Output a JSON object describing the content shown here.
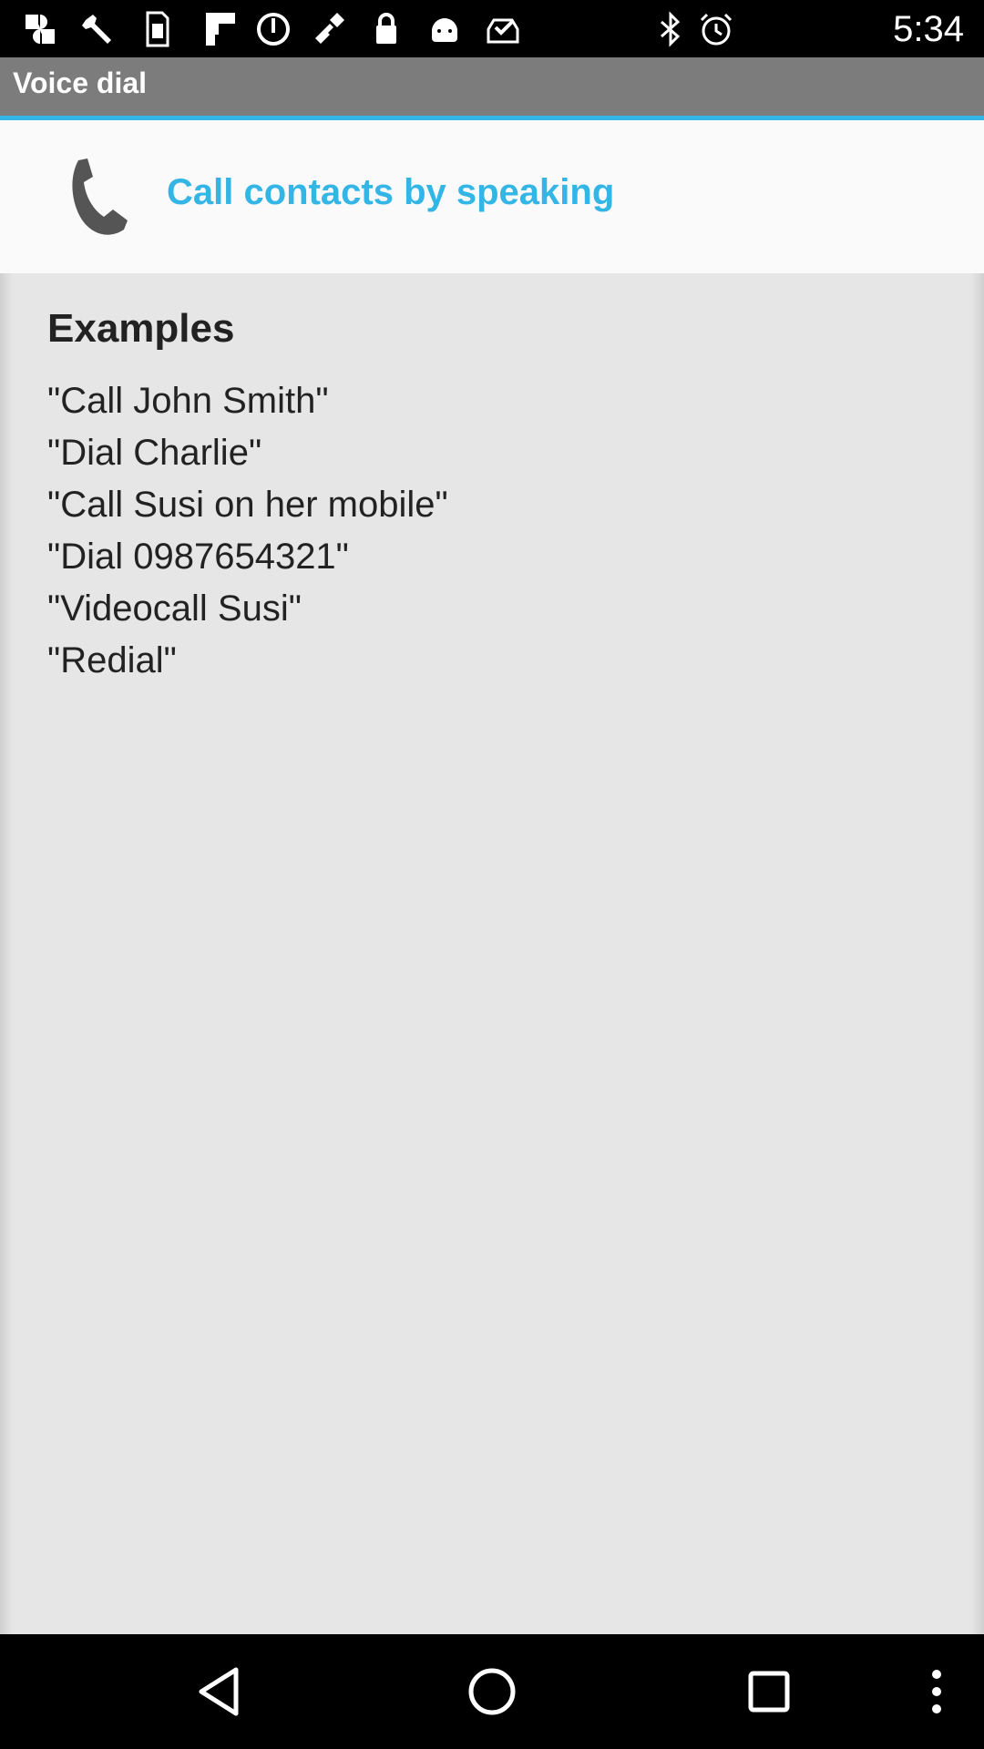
{
  "status_bar": {
    "time": "5:34",
    "left_icons": [
      "google-photos-icon",
      "wrench-icon",
      "sim-card-icon",
      "flipboard-icon",
      "no-entry-icon",
      "satellite-icon",
      "lock-icon",
      "android-icon",
      "inbox-check-icon"
    ],
    "right_icons": [
      "bluetooth-icon",
      "alarm-icon"
    ]
  },
  "app_bar": {
    "title": "Voice dial"
  },
  "header": {
    "icon": "phone-icon",
    "text": "Call contacts by speaking"
  },
  "examples": {
    "heading": "Examples",
    "items": [
      "\"Call John Smith\"",
      "\"Dial Charlie\"",
      "\"Call Susi on her mobile\"",
      "\"Dial 0987654321\"",
      "\"Videocall Susi\"",
      "\"Redial\""
    ]
  },
  "nav_bar": {
    "buttons": [
      "back-icon",
      "home-icon",
      "recents-icon",
      "overflow-menu-icon"
    ]
  },
  "colors": {
    "accent": "#33b5e5",
    "title_bar": "#7c7c7c",
    "content_bg": "#e6e6e6"
  }
}
